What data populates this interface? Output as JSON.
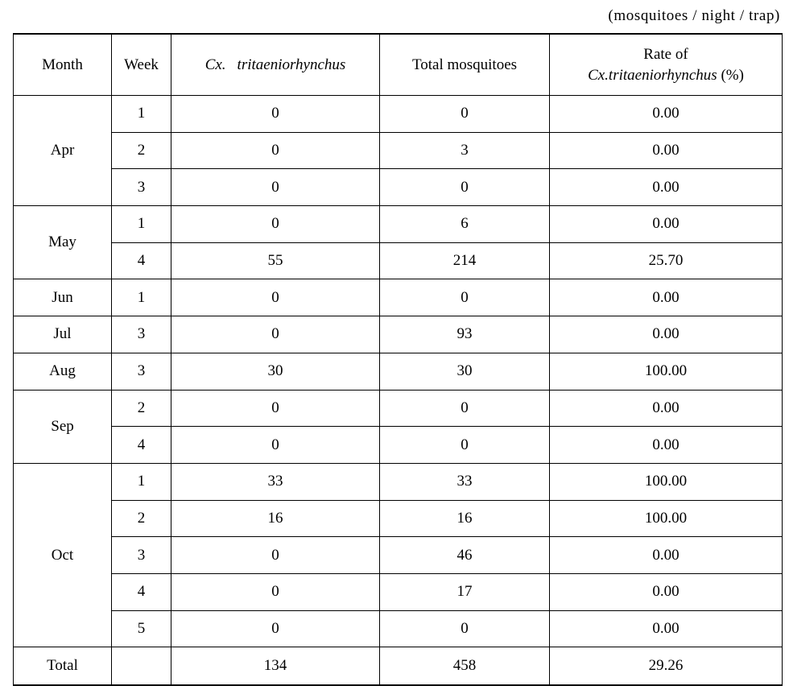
{
  "caption": "(mosquitoes / night / trap)",
  "table": {
    "headers": {
      "month": "Month",
      "week": "Week",
      "species_prefix": "Cx.",
      "species_name": "tritaeniorhynchus",
      "total": "Total mosquitoes",
      "rate_line1": "Rate of",
      "rate_species": "Cx.tritaeniorhynchus",
      "rate_unit": "(%)"
    },
    "groups": [
      {
        "month": "Apr",
        "rows": [
          {
            "week": "1",
            "cx": "0",
            "total": "0",
            "rate": "0.00"
          },
          {
            "week": "2",
            "cx": "0",
            "total": "3",
            "rate": "0.00"
          },
          {
            "week": "3",
            "cx": "0",
            "total": "0",
            "rate": "0.00"
          }
        ]
      },
      {
        "month": "May",
        "rows": [
          {
            "week": "1",
            "cx": "0",
            "total": "6",
            "rate": "0.00"
          },
          {
            "week": "4",
            "cx": "55",
            "total": "214",
            "rate": "25.70"
          }
        ]
      },
      {
        "month": "Jun",
        "rows": [
          {
            "week": "1",
            "cx": "0",
            "total": "0",
            "rate": "0.00"
          }
        ]
      },
      {
        "month": "Jul",
        "rows": [
          {
            "week": "3",
            "cx": "0",
            "total": "93",
            "rate": "0.00"
          }
        ]
      },
      {
        "month": "Aug",
        "rows": [
          {
            "week": "3",
            "cx": "30",
            "total": "30",
            "rate": "100.00"
          }
        ]
      },
      {
        "month": "Sep",
        "rows": [
          {
            "week": "2",
            "cx": "0",
            "total": "0",
            "rate": "0.00"
          },
          {
            "week": "4",
            "cx": "0",
            "total": "0",
            "rate": "0.00"
          }
        ]
      },
      {
        "month": "Oct",
        "rows": [
          {
            "week": "1",
            "cx": "33",
            "total": "33",
            "rate": "100.00"
          },
          {
            "week": "2",
            "cx": "16",
            "total": "16",
            "rate": "100.00"
          },
          {
            "week": "3",
            "cx": "0",
            "total": "46",
            "rate": "0.00"
          },
          {
            "week": "4",
            "cx": "0",
            "total": "17",
            "rate": "0.00"
          },
          {
            "week": "5",
            "cx": "0",
            "total": "0",
            "rate": "0.00"
          }
        ]
      }
    ],
    "total_row": {
      "label": "Total",
      "week": "",
      "cx": "134",
      "total": "458",
      "rate": "29.26"
    }
  }
}
